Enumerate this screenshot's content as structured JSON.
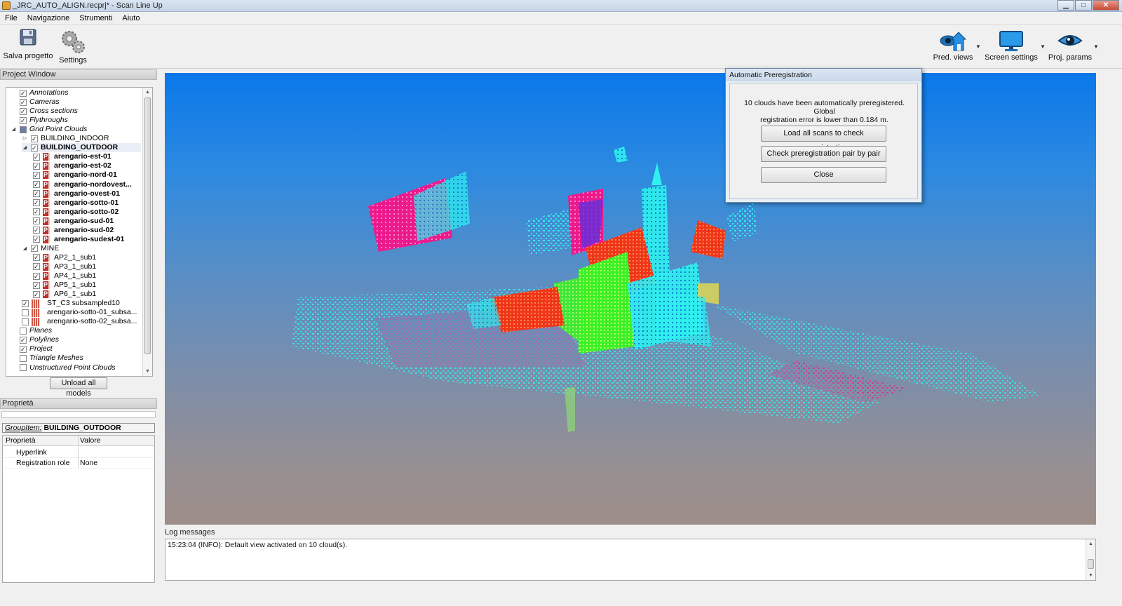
{
  "window": {
    "title": "_JRC_AUTO_ALIGN.recprj* - Scan Line Up",
    "minimize_glyph": "▁",
    "maximize_glyph": "□",
    "close_glyph": "✕"
  },
  "menu": [
    "File",
    "Navigazione",
    "Strumenti",
    "Aiuto"
  ],
  "toolbar": {
    "save_label": "Salva progetto",
    "settings_label": "Settings",
    "pred_views_label": "Pred. views",
    "screen_settings_label": "Screen settings",
    "proj_params_label": "Proj. params",
    "caret": "▼"
  },
  "project_window": {
    "title": "Project Window",
    "rows": [
      {
        "label": "Annotations",
        "checked": true,
        "style": "italic",
        "indent": 0,
        "expander": ""
      },
      {
        "label": "Cameras",
        "checked": true,
        "style": "italic",
        "indent": 0,
        "expander": ""
      },
      {
        "label": "Cross sections",
        "checked": true,
        "style": "italic",
        "indent": 0,
        "expander": ""
      },
      {
        "label": "Flythroughs",
        "checked": true,
        "style": "italic",
        "indent": 0,
        "expander": ""
      },
      {
        "label": "Grid Point Clouds",
        "checked": "partial",
        "style": "italic",
        "indent": 0,
        "expander": "◢"
      },
      {
        "label": "BUILDING_INDOOR",
        "checked": true,
        "style": "normal",
        "indent": 1,
        "expander": "▷"
      },
      {
        "label": "BUILDING_OUTDOOR",
        "checked": true,
        "style": "bold",
        "indent": 1,
        "expander": "◢",
        "selected": true
      },
      {
        "label": "arengario-est-01",
        "checked": true,
        "style": "bold",
        "indent": 2,
        "icon": "P"
      },
      {
        "label": "arengario-est-02",
        "checked": true,
        "style": "bold",
        "indent": 2,
        "icon": "P"
      },
      {
        "label": "arengario-nord-01",
        "checked": true,
        "style": "bold",
        "indent": 2,
        "icon": "P"
      },
      {
        "label": "arengario-nordovest...",
        "checked": true,
        "style": "bold",
        "indent": 2,
        "icon": "P"
      },
      {
        "label": "arengario-ovest-01",
        "checked": true,
        "style": "bold",
        "indent": 2,
        "icon": "P"
      },
      {
        "label": "arengario-sotto-01",
        "checked": true,
        "style": "bold",
        "indent": 2,
        "icon": "P"
      },
      {
        "label": "arengario-sotto-02",
        "checked": true,
        "style": "bold",
        "indent": 2,
        "icon": "P"
      },
      {
        "label": "arengario-sud-01",
        "checked": true,
        "style": "bold",
        "indent": 2,
        "icon": "P"
      },
      {
        "label": "arengario-sud-02",
        "checked": true,
        "style": "bold",
        "indent": 2,
        "icon": "P"
      },
      {
        "label": "arengario-sudest-01",
        "checked": true,
        "style": "bold",
        "indent": 2,
        "icon": "P"
      },
      {
        "label": "MINE",
        "checked": true,
        "style": "normal",
        "indent": 1,
        "expander": "◢"
      },
      {
        "label": "AP2_1_sub1",
        "checked": true,
        "style": "normal",
        "indent": 2,
        "icon": "P"
      },
      {
        "label": "AP3_1_sub1",
        "checked": true,
        "style": "normal",
        "indent": 2,
        "icon": "P"
      },
      {
        "label": "AP4_1_sub1",
        "checked": true,
        "style": "normal",
        "indent": 2,
        "icon": "P"
      },
      {
        "label": "AP5_1_sub1",
        "checked": true,
        "style": "normal",
        "indent": 2,
        "icon": "P"
      },
      {
        "label": "AP6_1_sub1",
        "checked": true,
        "style": "normal",
        "indent": 2,
        "icon": "P"
      },
      {
        "label": "ST_C3 subsampled10",
        "checked": true,
        "style": "normal",
        "indent": 1,
        "icon": "S"
      },
      {
        "label": "arengario-sotto-01_subsa...",
        "checked": false,
        "style": "normal",
        "indent": 1,
        "icon": "S"
      },
      {
        "label": "arengario-sotto-02_subsa...",
        "checked": false,
        "style": "normal",
        "indent": 1,
        "icon": "S"
      },
      {
        "label": "Planes",
        "checked": false,
        "style": "italic",
        "indent": 0,
        "expander": ""
      },
      {
        "label": "Polylines",
        "checked": true,
        "style": "italic",
        "indent": 0,
        "expander": ""
      },
      {
        "label": "Project",
        "checked": true,
        "style": "italic",
        "indent": 0,
        "expander": ""
      },
      {
        "label": "Triangle Meshes",
        "checked": false,
        "style": "italic",
        "indent": 0,
        "expander": ""
      },
      {
        "label": "Unstructured Point Clouds",
        "checked": false,
        "style": "italic",
        "indent": 0,
        "expander": ""
      }
    ],
    "scroll_up": "▲",
    "scroll_down": "▼",
    "unload_button": "Unload all models"
  },
  "properties": {
    "title": "Proprietà",
    "group_prefix": "GroupItem:",
    "group_name": "BUILDING_OUTDOOR",
    "col_property": "Proprietà",
    "col_value": "Valore",
    "rows": [
      {
        "key": "Hyperlink",
        "value": ""
      },
      {
        "key": "Registration role",
        "value": "None"
      }
    ]
  },
  "dialog": {
    "title": "Automatic Preregistration",
    "message_line1": "10 clouds have been automatically preregistered. Global",
    "message_line2": "registration error is lower than 0.184 m.",
    "btn_load": "Load all scans to check preregistration",
    "btn_check": "Check preregistration pair by pair",
    "btn_close": "Close"
  },
  "log": {
    "title": "Log messages",
    "lines": [
      "15:23:04 (INFO): Default view activated on 10 cloud(s)."
    ]
  },
  "colors": {
    "magenta": "#ec1a8c",
    "cyan": "#2ff0f0",
    "green": "#3cf02a",
    "red": "#f0351e",
    "purple": "#6a2ed8",
    "yellow": "#d7d35a"
  }
}
